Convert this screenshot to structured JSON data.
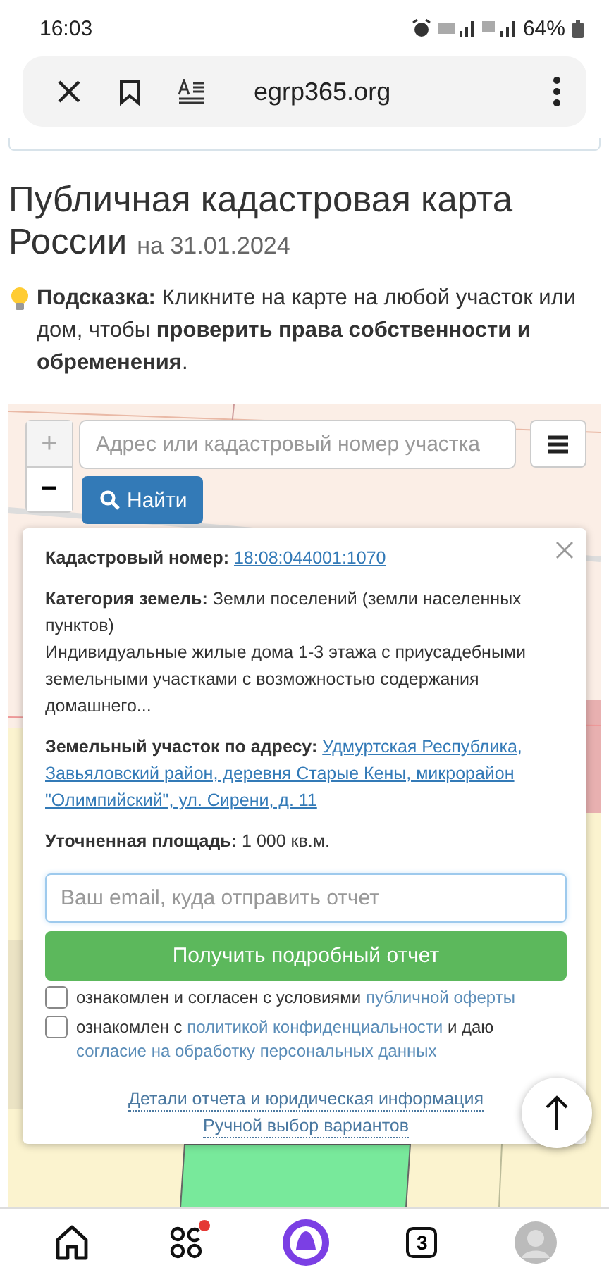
{
  "status_bar": {
    "time": "16:03",
    "battery": "64%"
  },
  "browser_bar": {
    "url": "egrp365.org"
  },
  "page": {
    "title": "Публичная кадастровая карта России",
    "date": "на 31.01.2024",
    "hint": "**Подсказка:** Кликните на карте на любой участок или дом, чтобы **проверить права собственности и обременения**."
  },
  "map": {
    "zoom_in": "+",
    "zoom_out": "−",
    "search_placeholder": "Адрес или кадастровый номер участка",
    "search_button": "Найти"
  },
  "popup": {
    "fields": [
      {
        "label": "Кадастровый номер:",
        "value": "18:08:044001:1070",
        "kind": "link"
      },
      {
        "label": "Категория земель:",
        "value": "Земли поселений (земли населенных пунктов)",
        "note": "Индивидуальные жилые дома 1-3 этажа с приусадебными земельными участками с возможностью содержания домашнего...",
        "kind": "text"
      },
      {
        "label": "Земельный участок по адресу:",
        "value": "Удмуртская Республика, Завьяловский район, деревня Старые Кены, микрорайон \"Олимпийский\", ул. Сирени, д. 11",
        "kind": "link"
      },
      {
        "label": "Уточненная площадь:",
        "value": "1 000 кв.м.",
        "kind": "text"
      }
    ],
    "email_placeholder": "Ваш email, куда отправить отчет",
    "submit": "Получить подробный отчет",
    "agreements": [
      {
        "checked": false,
        "parts": [
          {
            "text": "ознакомлен и согласен с условиями",
            "link": false
          },
          {
            "text": "публичной оферты",
            "link": true
          }
        ]
      },
      {
        "checked": false,
        "parts": [
          {
            "text": "ознакомлен с",
            "link": false
          },
          {
            "text": "политикой конфиденциальности",
            "link": true
          },
          {
            "text": "и даю",
            "link": false
          },
          {
            "text": "согласие",
            "link": true
          },
          {
            "text": "на обработку персональных данных",
            "link": true
          }
        ]
      }
    ],
    "footer_links": [
      "Детали отчета и юридическая информация",
      "Ручной выбор вариантов"
    ]
  },
  "bottom_nav": {
    "tab_count": "3",
    "apps_notification": true
  }
}
